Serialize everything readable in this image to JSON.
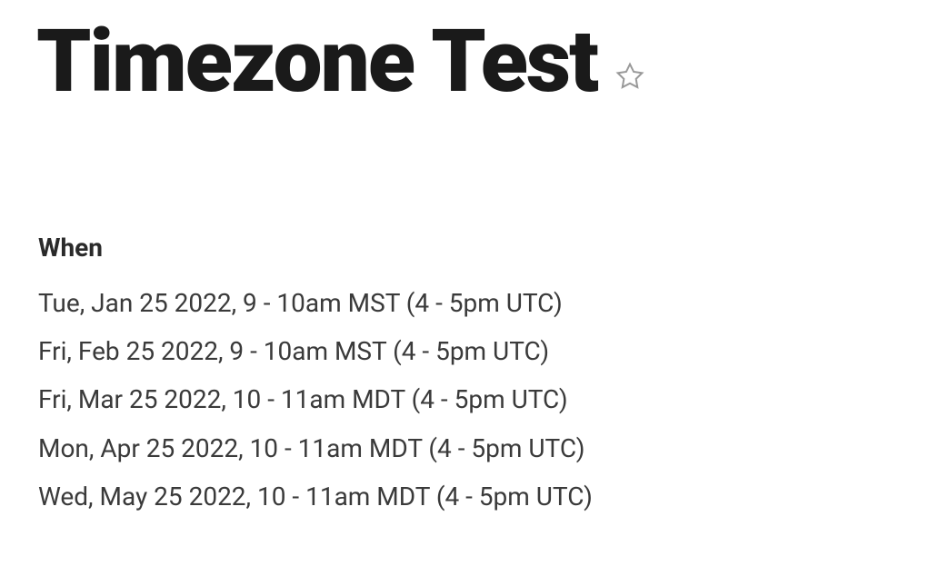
{
  "title": "Timezone Test",
  "when": {
    "label": "When",
    "dates": [
      "Tue, Jan 25 2022, 9 - 10am MST (4 - 5pm UTC)",
      "Fri, Feb 25 2022, 9 - 10am MST (4 - 5pm UTC)",
      "Fri, Mar 25 2022, 10 - 11am MDT (4 - 5pm UTC)",
      "Mon, Apr 25 2022, 10 - 11am MDT (4 - 5pm UTC)",
      "Wed, May 25 2022, 10 - 11am MDT (4 - 5pm UTC)"
    ]
  }
}
